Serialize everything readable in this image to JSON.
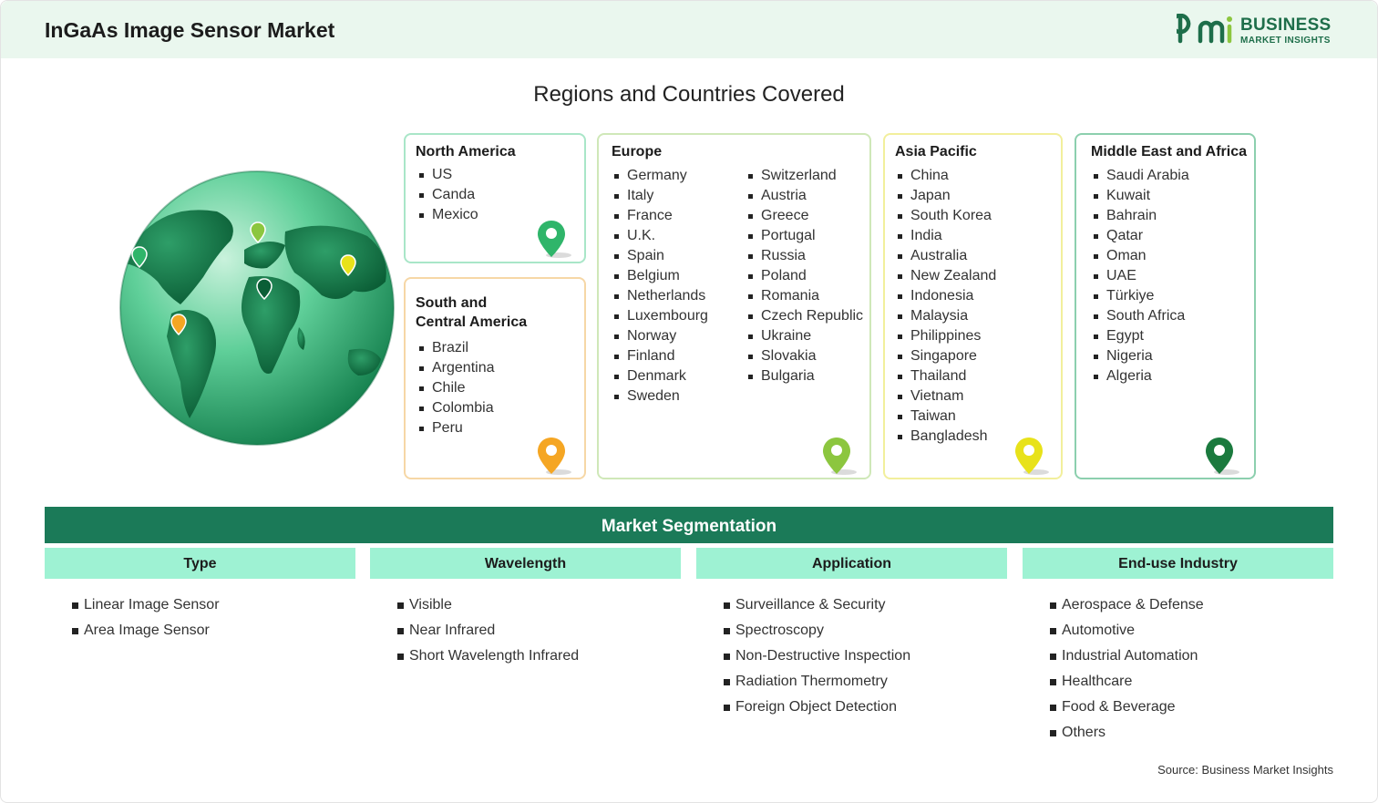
{
  "header": {
    "title": "InGaAs Image Sensor Market"
  },
  "logo": {
    "line1": "BUSINESS",
    "line2": "MARKET INSIGHTS"
  },
  "regions_title": "Regions and Countries Covered",
  "regions": {
    "north_america": {
      "title": "North America",
      "countries": [
        "US",
        "Canda",
        "Mexico"
      ]
    },
    "south_central_america": {
      "title_line1": "South and",
      "title_line2": "Central America",
      "countries": [
        "Brazil",
        "Argentina",
        "Chile",
        "Colombia",
        "Peru"
      ]
    },
    "europe": {
      "title": "Europe",
      "countries_col1": [
        "Germany",
        "Italy",
        "France",
        "U.K.",
        "Spain",
        "Belgium",
        "Netherlands",
        "Luxembourg",
        "Norway",
        "Finland",
        "Denmark",
        "Sweden"
      ],
      "countries_col2": [
        "Switzerland",
        "Austria",
        "Greece",
        "Portugal",
        "Russia",
        "Poland",
        "Romania",
        "Czech Republic",
        "Ukraine",
        "Slovakia",
        "Bulgaria"
      ]
    },
    "asia_pacific": {
      "title": "Asia Pacific",
      "countries": [
        "China",
        "Japan",
        "South Korea",
        "India",
        "Australia",
        "New Zealand",
        "Indonesia",
        "Malaysia",
        "Philippines",
        "Singapore",
        "Thailand",
        "Vietnam",
        "Taiwan",
        "Bangladesh"
      ]
    },
    "middle_east_africa": {
      "title": "Middle East and Africa",
      "countries": [
        "Saudi Arabia",
        "Kuwait",
        "Bahrain",
        "Qatar",
        "Oman",
        "UAE",
        "Türkiye",
        "South Africa",
        "Egypt",
        "Nigeria",
        "Algeria"
      ]
    }
  },
  "colors": {
    "north_america": "#2fb56a",
    "south_central_america": "#f5a623",
    "europe": "#8cc63f",
    "asia_pacific": "#e8e21a",
    "middle_east_africa": "#1b7a3e",
    "segmentation_bar": "#1b7a58",
    "segmentation_head": "#9ef2d3"
  },
  "segmentation": {
    "title": "Market Segmentation",
    "columns": [
      {
        "header": "Type",
        "items": [
          "Linear Image Sensor",
          "Area Image Sensor"
        ]
      },
      {
        "header": "Wavelength",
        "items": [
          "Visible",
          "Near Infrared",
          "Short Wavelength Infrared"
        ]
      },
      {
        "header": "Application",
        "items": [
          "Surveillance & Security",
          "Spectroscopy",
          "Non-Destructive Inspection",
          "Radiation Thermometry",
          "Foreign Object Detection"
        ]
      },
      {
        "header": "End-use Industry",
        "items": [
          "Aerospace & Defense",
          "Automotive",
          "Industrial Automation",
          "Healthcare",
          "Food & Beverage",
          "Others"
        ]
      }
    ]
  },
  "source": "Source: Business Market Insights"
}
